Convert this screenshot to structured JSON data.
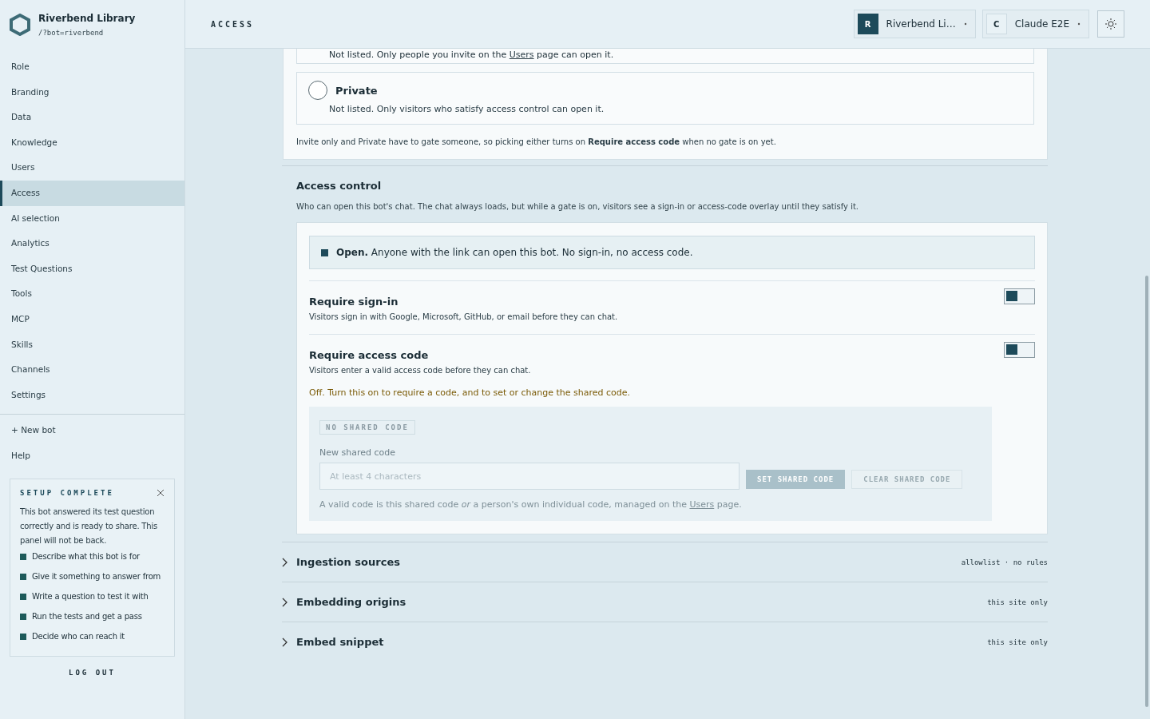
{
  "brand": {
    "name": "Riverbend Library",
    "path": "/?bot=riverbend"
  },
  "nav": [
    {
      "label": "Role",
      "selected": false
    },
    {
      "label": "Branding",
      "selected": false
    },
    {
      "label": "Data",
      "selected": false
    },
    {
      "label": "Knowledge",
      "selected": false
    },
    {
      "label": "Users",
      "selected": false
    },
    {
      "label": "Access",
      "selected": true
    },
    {
      "label": "AI selection",
      "selected": false
    },
    {
      "label": "Analytics",
      "selected": false
    },
    {
      "label": "Test Questions",
      "selected": false
    },
    {
      "label": "Tools",
      "selected": false
    },
    {
      "label": "MCP",
      "selected": false
    },
    {
      "label": "Skills",
      "selected": false
    },
    {
      "label": "Channels",
      "selected": false
    },
    {
      "label": "Settings",
      "selected": false
    }
  ],
  "nav_extra": [
    "+ New bot",
    "Help"
  ],
  "setup_panel": {
    "title": "SETUP COMPLETE",
    "text": "This bot answered its test question correctly and is ready to share. This panel will not be back.",
    "steps": [
      {
        "label": "Describe what this bot is for",
        "done": true
      },
      {
        "label": "Give it something to answer from",
        "done": true
      },
      {
        "label": "Write a question to test it with",
        "done": true
      },
      {
        "label": "Run the tests and get a pass",
        "done": true
      },
      {
        "label": "Decide who can reach it",
        "done": true
      }
    ]
  },
  "logout": "LOG OUT",
  "header": {
    "title": "ACCESS",
    "workspace": {
      "initial": "R",
      "name": "Riverbend Li…"
    },
    "user": {
      "initial": "C",
      "name": "Claude E2E"
    }
  },
  "visibility": {
    "partial_option": {
      "before": "Not listed. Only people you invite on the",
      "link": "Users",
      "after": "page can open it."
    },
    "options": [
      {
        "label": "Private",
        "description": "Not listed. Only visitors who satisfy access control can open it.",
        "selected": false
      }
    ],
    "note": "Invite only and Private have to gate someone, so picking either turns on **Require access code** when no gate is on yet."
  },
  "access_control": {
    "title": "Access control",
    "description": "Who can open this bot's chat. The chat always loads, but while a gate is on, visitors see a sign-in or access-code overlay until they satisfy it.",
    "status": "**Open.** Anyone with the link can open this bot. No sign-in, no access code.",
    "gates": [
      {
        "title": "Require sign-in",
        "description": "Visitors sign in with Google, Microsoft, GitHub, or email before they can chat.",
        "on": false
      },
      {
        "title": "Require access code",
        "description": "Visitors enter a valid access code before they can chat.",
        "on": false,
        "note": "Off. Turn this on to require a code, and to set or change the shared code."
      }
    ],
    "code_panel": {
      "badge": "NO SHARED CODE",
      "field_label": "New shared code",
      "placeholder": "At least 4 characters",
      "buttons": [
        {
          "label": "SET SHARED CODE",
          "disabled": false
        },
        {
          "label": "CLEAR SHARED CODE",
          "disabled": true
        }
      ],
      "hint": {
        "before": "A valid code is this shared code *or* a person's own individual code, managed on the",
        "link": "Users",
        "after": "page."
      }
    }
  },
  "sections": [
    {
      "title": "Ingestion sources",
      "summary": "allowlist · no rules",
      "expanded": false
    },
    {
      "title": "Embedding origins",
      "summary": "this site only",
      "expanded": false
    },
    {
      "title": "Embed snippet",
      "summary": "this site only",
      "expanded": false
    }
  ]
}
